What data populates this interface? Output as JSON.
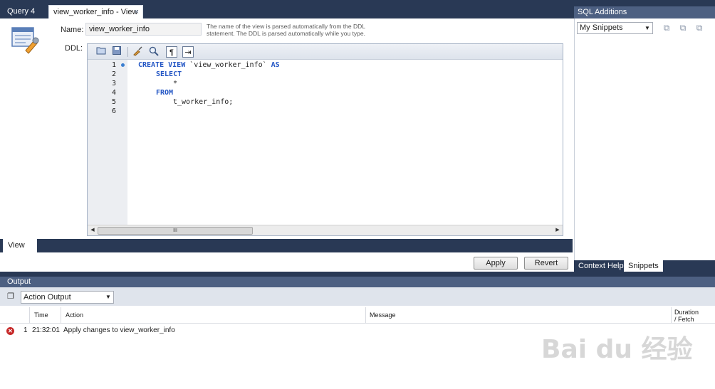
{
  "tabs": [
    {
      "label": "Query 4"
    },
    {
      "label": "view_worker_info - View",
      "close": "×"
    }
  ],
  "editor": {
    "name_label": "Name:",
    "name_value": "view_worker_info",
    "hint": "The name of the view is parsed automatically from the DDL statement. The DDL is parsed automatically while you type.",
    "ddl_label": "DDL:",
    "toolbar_icons": [
      "open-folder-icon",
      "save-icon",
      "beautify-brush-icon",
      "find-icon",
      "invisible-chars-icon",
      "word-wrap-icon"
    ],
    "line_numbers": [
      "1",
      "2",
      "3",
      "4",
      "5",
      "6"
    ],
    "code": {
      "l1_kw": "CREATE VIEW",
      "l1_name": " `view_worker_info` ",
      "l1_kw2": "AS",
      "l2": "SELECT",
      "l3": "*",
      "l4": "FROM",
      "l5": "t_worker_info;"
    },
    "scroll_thumb_glyph": "III"
  },
  "bottom_tabs": {
    "view": "View"
  },
  "buttons": {
    "apply": "Apply",
    "revert": "Revert"
  },
  "sql_additions": {
    "title": "SQL Additions",
    "snippet_select": "My Snippets",
    "tabs": [
      "Context Help",
      "Snippets"
    ],
    "active_tab": "Snippets"
  },
  "output": {
    "title": "Output",
    "select_value": "Action Output",
    "columns": [
      "Time",
      "Action",
      "Message",
      "Duration / Fetch"
    ],
    "duration_line1": "Duration",
    "duration_line2": "/ Fetch",
    "rows": [
      {
        "status": "error",
        "index": "1",
        "time": "21:32:01",
        "action": "Apply changes to view_worker_info",
        "message": "",
        "duration": ""
      }
    ]
  },
  "watermark": "Bai du 经验"
}
